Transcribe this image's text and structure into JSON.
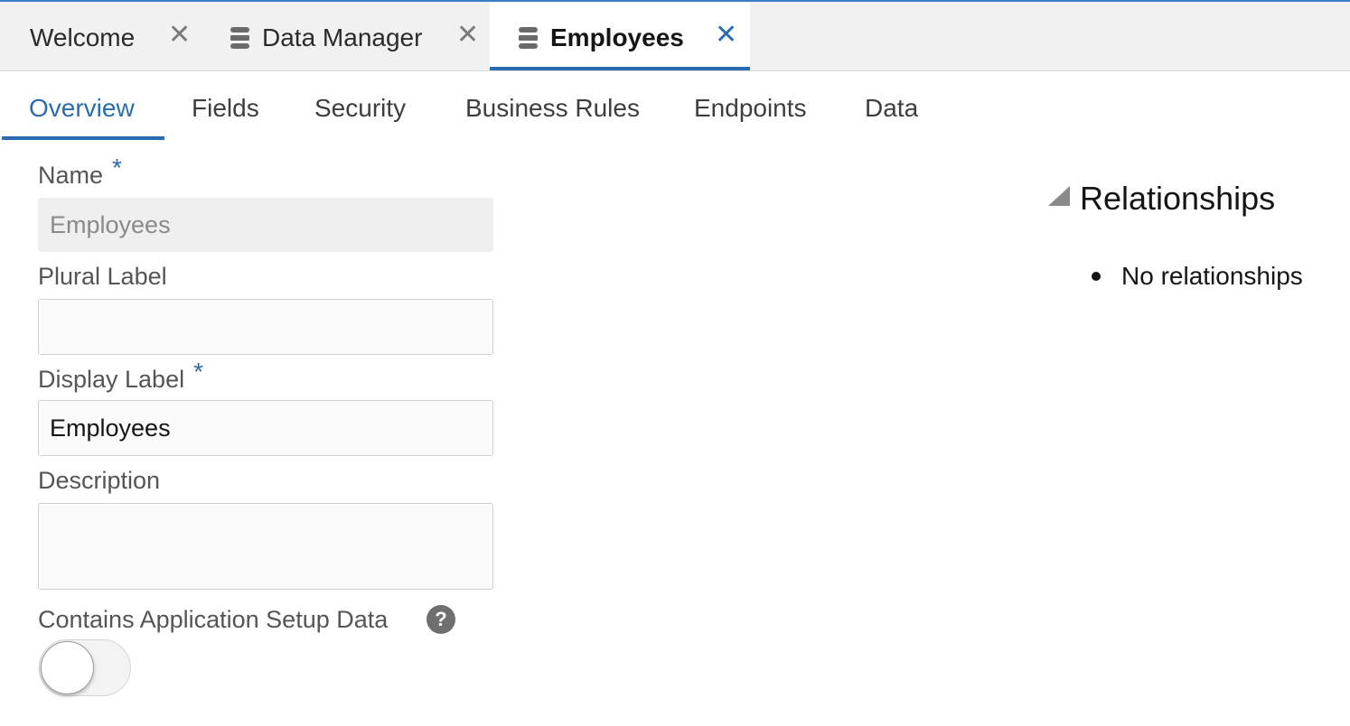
{
  "doc_tabs": [
    {
      "label": "Welcome",
      "icon": "none",
      "active": false
    },
    {
      "label": "Data Manager",
      "icon": "database-icon",
      "active": false
    },
    {
      "label": "Employees",
      "icon": "database-icon",
      "active": true
    }
  ],
  "close_glyph": "✕",
  "sub_tabs": [
    {
      "label": "Overview",
      "active": true
    },
    {
      "label": "Fields"
    },
    {
      "label": "Security"
    },
    {
      "label": "Business Rules"
    },
    {
      "label": "Endpoints"
    },
    {
      "label": "Data"
    }
  ],
  "form": {
    "name_label": "Name",
    "name_value": "Employees",
    "required_mark": "*",
    "plural_label": "Plural Label",
    "plural_value": "",
    "display_label": "Display Label",
    "display_value": "Employees",
    "description_label": "Description",
    "description_value": "",
    "setup_data_label": "Contains Application Setup Data",
    "help_glyph": "?",
    "setup_data_enabled": false
  },
  "relationships": {
    "title": "Relationships",
    "items": [
      "No relationships"
    ]
  },
  "colors": {
    "accent": "#2b6cb0",
    "tab_strip": "#f1f1f2",
    "muted_text": "#555555"
  }
}
